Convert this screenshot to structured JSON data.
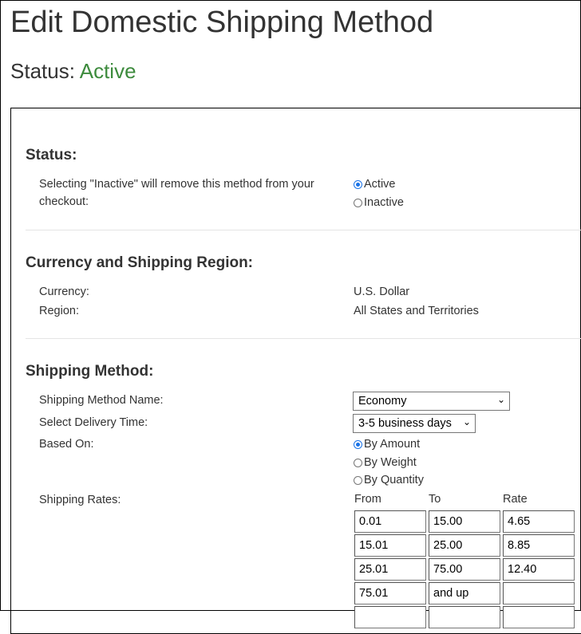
{
  "page": {
    "title": "Edit Domestic Shipping Method",
    "status_label": "Status: ",
    "status_value": "Active"
  },
  "status_section": {
    "heading": "Status:",
    "description": "Selecting \"Inactive\" will remove this method from your checkout:",
    "options": [
      {
        "label": "Active",
        "selected": true
      },
      {
        "label": "Inactive",
        "selected": false
      }
    ]
  },
  "region_section": {
    "heading": "Currency and Shipping Region:",
    "currency_label": "Currency:",
    "currency_value": "U.S. Dollar",
    "region_label": "Region:",
    "region_value": "All States and Territories"
  },
  "method_section": {
    "heading": "Shipping Method:",
    "name_label": "Shipping Method Name:",
    "name_value": "Economy",
    "delivery_label": "Select Delivery Time:",
    "delivery_value": "3-5 business days",
    "based_on_label": "Based On:",
    "based_on_options": [
      {
        "label": "By Amount",
        "selected": true
      },
      {
        "label": "By Weight",
        "selected": false
      },
      {
        "label": "By Quantity",
        "selected": false
      }
    ],
    "rates_label": "Shipping Rates:",
    "rates_columns": [
      "From",
      "To",
      "Rate"
    ],
    "rates": [
      {
        "from": "0.01",
        "to": "15.00",
        "rate": "4.65"
      },
      {
        "from": "15.01",
        "to": "25.00",
        "rate": "8.85"
      },
      {
        "from": "25.01",
        "to": "75.00",
        "rate": "12.40"
      },
      {
        "from": "75.01",
        "to": "and up",
        "rate": ""
      }
    ]
  },
  "icons": {
    "select_arrow": "chevron-down-icon"
  },
  "colors": {
    "active_status": "#3d8b3d",
    "radio_selected": "#1a73e8"
  }
}
